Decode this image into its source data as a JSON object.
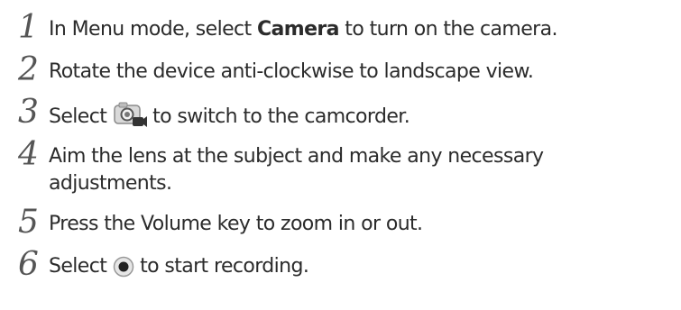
{
  "steps": [
    {
      "number": "1",
      "text_before": "In Menu mode, select ",
      "bold": "Camera",
      "text_after": " to turn on the camera."
    },
    {
      "number": "2",
      "text": "Rotate the device anti-clockwise to landscape view."
    },
    {
      "number": "3",
      "text_before": "Select ",
      "icon": "camera-camcorder-switch-icon",
      "text_after": " to switch to the camcorder."
    },
    {
      "number": "4",
      "line1": "Aim the lens at the subject and make any necessary",
      "line2": "adjustments."
    },
    {
      "number": "5",
      "text": "Press the Volume key to zoom in or out."
    },
    {
      "number": "6",
      "text_before": "Select ",
      "icon": "record-button-icon",
      "text_after": " to start recording."
    }
  ]
}
